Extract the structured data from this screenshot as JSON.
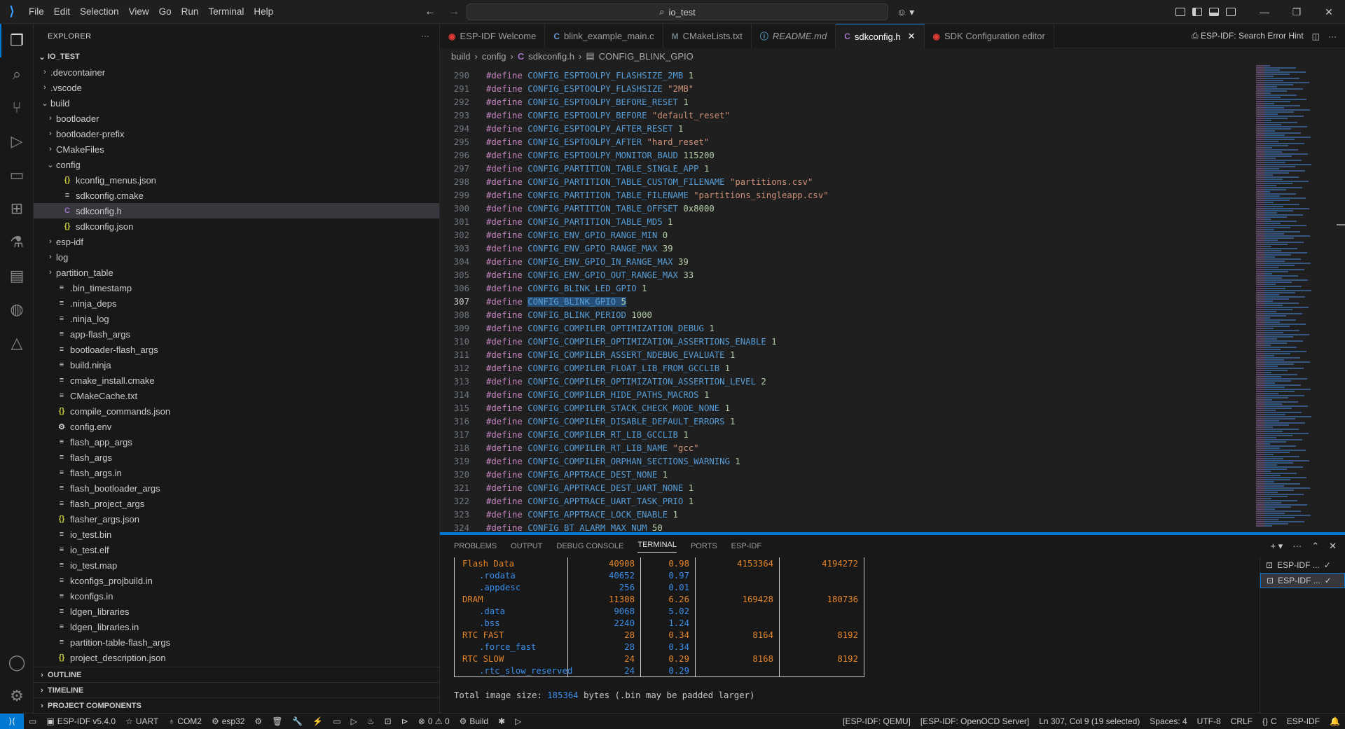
{
  "titlebar": {
    "menu": [
      "File",
      "Edit",
      "Selection",
      "View",
      "Go",
      "Run",
      "Terminal",
      "Help"
    ],
    "search": "io_test"
  },
  "explorer": {
    "header": "EXPLORER",
    "folder": "IO_TEST",
    "items": [
      {
        "label": ".devcontainer",
        "type": "folder",
        "depth": 1,
        "open": false
      },
      {
        "label": ".vscode",
        "type": "folder",
        "depth": 1,
        "open": false
      },
      {
        "label": "build",
        "type": "folder",
        "depth": 1,
        "open": true
      },
      {
        "label": "bootloader",
        "type": "folder",
        "depth": 2,
        "open": false
      },
      {
        "label": "bootloader-prefix",
        "type": "folder",
        "depth": 2,
        "open": false
      },
      {
        "label": "CMakeFiles",
        "type": "folder",
        "depth": 2,
        "open": false
      },
      {
        "label": "config",
        "type": "folder",
        "depth": 2,
        "open": true
      },
      {
        "label": "kconfig_menus.json",
        "type": "json",
        "depth": 3
      },
      {
        "label": "sdkconfig.cmake",
        "type": "file",
        "depth": 3
      },
      {
        "label": "sdkconfig.h",
        "type": "c",
        "depth": 3,
        "selected": true
      },
      {
        "label": "sdkconfig.json",
        "type": "json",
        "depth": 3
      },
      {
        "label": "esp-idf",
        "type": "folder",
        "depth": 2,
        "open": false
      },
      {
        "label": "log",
        "type": "folder",
        "depth": 2,
        "open": false
      },
      {
        "label": "partition_table",
        "type": "folder",
        "depth": 2,
        "open": false
      },
      {
        "label": ".bin_timestamp",
        "type": "file",
        "depth": 2
      },
      {
        "label": ".ninja_deps",
        "type": "file",
        "depth": 2
      },
      {
        "label": ".ninja_log",
        "type": "file",
        "depth": 2
      },
      {
        "label": "app-flash_args",
        "type": "file",
        "depth": 2
      },
      {
        "label": "bootloader-flash_args",
        "type": "file",
        "depth": 2
      },
      {
        "label": "build.ninja",
        "type": "file",
        "depth": 2
      },
      {
        "label": "cmake_install.cmake",
        "type": "file",
        "depth": 2
      },
      {
        "label": "CMakeCache.txt",
        "type": "file",
        "depth": 2
      },
      {
        "label": "compile_commands.json",
        "type": "json",
        "depth": 2
      },
      {
        "label": "config.env",
        "type": "gear",
        "depth": 2
      },
      {
        "label": "flash_app_args",
        "type": "file",
        "depth": 2
      },
      {
        "label": "flash_args",
        "type": "file",
        "depth": 2
      },
      {
        "label": "flash_args.in",
        "type": "file",
        "depth": 2
      },
      {
        "label": "flash_bootloader_args",
        "type": "file",
        "depth": 2
      },
      {
        "label": "flash_project_args",
        "type": "file",
        "depth": 2
      },
      {
        "label": "flasher_args.json",
        "type": "json",
        "depth": 2
      },
      {
        "label": "io_test.bin",
        "type": "file",
        "depth": 2
      },
      {
        "label": "io_test.elf",
        "type": "file",
        "depth": 2
      },
      {
        "label": "io_test.map",
        "type": "file",
        "depth": 2
      },
      {
        "label": "kconfigs_projbuild.in",
        "type": "file",
        "depth": 2
      },
      {
        "label": "kconfigs.in",
        "type": "file",
        "depth": 2
      },
      {
        "label": "ldgen_libraries",
        "type": "file",
        "depth": 2
      },
      {
        "label": "ldgen_libraries.in",
        "type": "file",
        "depth": 2
      },
      {
        "label": "partition-table-flash_args",
        "type": "file",
        "depth": 2
      },
      {
        "label": "project_description.json",
        "type": "json",
        "depth": 2
      }
    ],
    "bottom_sections": [
      "OUTLINE",
      "TIMELINE",
      "PROJECT COMPONENTS"
    ]
  },
  "tabs": [
    {
      "label": "ESP-IDF Welcome",
      "icon": "esp",
      "color": "#e53935"
    },
    {
      "label": "blink_example_main.c",
      "icon": "C",
      "color": "#659ad2"
    },
    {
      "label": "CMakeLists.txt",
      "icon": "M",
      "color": "#6d8086"
    },
    {
      "label": "README.md",
      "icon": "ⓘ",
      "color": "#519aba",
      "italic": true
    },
    {
      "label": "sdkconfig.h",
      "icon": "C",
      "color": "#a074c4",
      "active": true
    },
    {
      "label": "SDK Configuration editor",
      "icon": "esp",
      "color": "#e53935"
    }
  ],
  "tab_actions": {
    "search_error": "ESP-IDF: Search Error Hint"
  },
  "breadcrumb": [
    "build",
    "config",
    "sdkconfig.h",
    "CONFIG_BLINK_GPIO"
  ],
  "code": [
    {
      "n": "290",
      "m": "CONFIG_ESPTOOLPY_FLASHSIZE_2MB",
      "v": "1",
      "t": "num"
    },
    {
      "n": "291",
      "m": "CONFIG_ESPTOOLPY_FLASHSIZE",
      "v": "\"2MB\"",
      "t": "str"
    },
    {
      "n": "292",
      "m": "CONFIG_ESPTOOLPY_BEFORE_RESET",
      "v": "1",
      "t": "num"
    },
    {
      "n": "293",
      "m": "CONFIG_ESPTOOLPY_BEFORE",
      "v": "\"default_reset\"",
      "t": "str"
    },
    {
      "n": "294",
      "m": "CONFIG_ESPTOOLPY_AFTER_RESET",
      "v": "1",
      "t": "num"
    },
    {
      "n": "295",
      "m": "CONFIG_ESPTOOLPY_AFTER",
      "v": "\"hard_reset\"",
      "t": "str"
    },
    {
      "n": "296",
      "m": "CONFIG_ESPTOOLPY_MONITOR_BAUD",
      "v": "115200",
      "t": "num"
    },
    {
      "n": "297",
      "m": "CONFIG_PARTITION_TABLE_SINGLE_APP",
      "v": "1",
      "t": "num"
    },
    {
      "n": "298",
      "m": "CONFIG_PARTITION_TABLE_CUSTOM_FILENAME",
      "v": "\"partitions.csv\"",
      "t": "str"
    },
    {
      "n": "299",
      "m": "CONFIG_PARTITION_TABLE_FILENAME",
      "v": "\"partitions_singleapp.csv\"",
      "t": "str"
    },
    {
      "n": "300",
      "m": "CONFIG_PARTITION_TABLE_OFFSET",
      "v": "0x8000",
      "t": "num"
    },
    {
      "n": "301",
      "m": "CONFIG_PARTITION_TABLE_MD5",
      "v": "1",
      "t": "num"
    },
    {
      "n": "302",
      "m": "CONFIG_ENV_GPIO_RANGE_MIN",
      "v": "0",
      "t": "num"
    },
    {
      "n": "303",
      "m": "CONFIG_ENV_GPIO_RANGE_MAX",
      "v": "39",
      "t": "num"
    },
    {
      "n": "304",
      "m": "CONFIG_ENV_GPIO_IN_RANGE_MAX",
      "v": "39",
      "t": "num"
    },
    {
      "n": "305",
      "m": "CONFIG_ENV_GPIO_OUT_RANGE_MAX",
      "v": "33",
      "t": "num"
    },
    {
      "n": "306",
      "m": "CONFIG_BLINK_LED_GPIO",
      "v": "1",
      "t": "num"
    },
    {
      "n": "307",
      "m": "CONFIG_BLINK_GPIO",
      "v": "5",
      "t": "num",
      "current": true
    },
    {
      "n": "308",
      "m": "CONFIG_BLINK_PERIOD",
      "v": "1000",
      "t": "num"
    },
    {
      "n": "309",
      "m": "CONFIG_COMPILER_OPTIMIZATION_DEBUG",
      "v": "1",
      "t": "num"
    },
    {
      "n": "310",
      "m": "CONFIG_COMPILER_OPTIMIZATION_ASSERTIONS_ENABLE",
      "v": "1",
      "t": "num"
    },
    {
      "n": "311",
      "m": "CONFIG_COMPILER_ASSERT_NDEBUG_EVALUATE",
      "v": "1",
      "t": "num"
    },
    {
      "n": "312",
      "m": "CONFIG_COMPILER_FLOAT_LIB_FROM_GCCLIB",
      "v": "1",
      "t": "num"
    },
    {
      "n": "313",
      "m": "CONFIG_COMPILER_OPTIMIZATION_ASSERTION_LEVEL",
      "v": "2",
      "t": "num"
    },
    {
      "n": "314",
      "m": "CONFIG_COMPILER_HIDE_PATHS_MACROS",
      "v": "1",
      "t": "num"
    },
    {
      "n": "315",
      "m": "CONFIG_COMPILER_STACK_CHECK_MODE_NONE",
      "v": "1",
      "t": "num"
    },
    {
      "n": "316",
      "m": "CONFIG_COMPILER_DISABLE_DEFAULT_ERRORS",
      "v": "1",
      "t": "num"
    },
    {
      "n": "317",
      "m": "CONFIG_COMPILER_RT_LIB_GCCLIB",
      "v": "1",
      "t": "num"
    },
    {
      "n": "318",
      "m": "CONFIG_COMPILER_RT_LIB_NAME",
      "v": "\"gcc\"",
      "t": "str"
    },
    {
      "n": "319",
      "m": "CONFIG_COMPILER_ORPHAN_SECTIONS_WARNING",
      "v": "1",
      "t": "num"
    },
    {
      "n": "320",
      "m": "CONFIG_APPTRACE_DEST_NONE",
      "v": "1",
      "t": "num"
    },
    {
      "n": "321",
      "m": "CONFIG_APPTRACE_DEST_UART_NONE",
      "v": "1",
      "t": "num"
    },
    {
      "n": "322",
      "m": "CONFIG_APPTRACE_UART_TASK_PRIO",
      "v": "1",
      "t": "num"
    },
    {
      "n": "323",
      "m": "CONFIG_APPTRACE_LOCK_ENABLE",
      "v": "1",
      "t": "num"
    },
    {
      "n": "324",
      "m": "CONFIG_BT_ALARM_MAX_NUM",
      "v": "50",
      "t": "num"
    }
  ],
  "define_keyword": "#define",
  "panel": {
    "tabs": [
      "PROBLEMS",
      "OUTPUT",
      "DEBUG CONSOLE",
      "TERMINAL",
      "PORTS",
      "ESP-IDF"
    ],
    "active_tab": "TERMINAL",
    "table": [
      {
        "name": "Flash Data",
        "used": "40908",
        "pct": "0.98",
        "remain": "4153364",
        "total": "4194272",
        "sub": false
      },
      {
        "name": ".rodata",
        "used": "40652",
        "pct": "0.97",
        "remain": "",
        "total": "",
        "sub": true
      },
      {
        "name": ".appdesc",
        "used": "256",
        "pct": "0.01",
        "remain": "",
        "total": "",
        "sub": true
      },
      {
        "name": "DRAM",
        "used": "11308",
        "pct": "6.26",
        "remain": "169428",
        "total": "180736",
        "sub": false
      },
      {
        "name": ".data",
        "used": "9068",
        "pct": "5.02",
        "remain": "",
        "total": "",
        "sub": true
      },
      {
        "name": ".bss",
        "used": "2240",
        "pct": "1.24",
        "remain": "",
        "total": "",
        "sub": true
      },
      {
        "name": "RTC FAST",
        "used": "28",
        "pct": "0.34",
        "remain": "8164",
        "total": "8192",
        "sub": false
      },
      {
        "name": ".force_fast",
        "used": "28",
        "pct": "0.34",
        "remain": "",
        "total": "",
        "sub": true
      },
      {
        "name": "RTC SLOW",
        "used": "24",
        "pct": "0.29",
        "remain": "8168",
        "total": "8192",
        "sub": false
      },
      {
        "name": ".rtc_slow_reserved",
        "used": "24",
        "pct": "0.29",
        "remain": "",
        "total": "",
        "sub": true
      }
    ],
    "total_prefix": "Total image size: ",
    "total_value": "185364",
    "total_suffix": " bytes (.bin may be padded larger)",
    "terminals": [
      "ESP-IDF ...",
      "ESP-IDF ..."
    ]
  },
  "statusbar": {
    "left": [
      "ESP-IDF v5.4.0",
      "UART",
      "COM2",
      "esp32",
      "",
      "",
      "",
      "",
      "",
      "",
      "",
      "",
      "0 ⚠ 0",
      "Build",
      "",
      ""
    ],
    "idf_version": "ESP-IDF v5.4.0",
    "uart": "UART",
    "port": "COM2",
    "target": "esp32",
    "problems": "0 ⚠ 0",
    "build": "Build",
    "qemu": "[ESP-IDF: QEMU]",
    "openocd": "[ESP-IDF: OpenOCD Server]",
    "position": "Ln 307, Col 9 (19 selected)",
    "spaces": "Spaces: 4",
    "encoding": "UTF-8",
    "eol": "CRLF",
    "language": "C",
    "idf": "ESP-IDF"
  }
}
